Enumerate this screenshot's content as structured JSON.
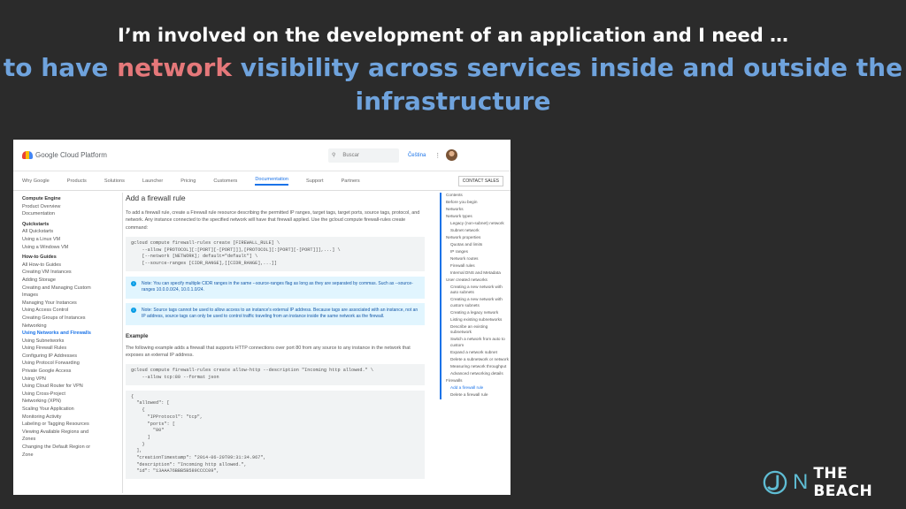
{
  "slide": {
    "title": "I’m involved on the development of an application and I need …",
    "subtitle_pre": "to have ",
    "subtitle_highlight": "network",
    "subtitle_post": " visibility across services inside and outside the infrastructure",
    "brand_n": "N",
    "brand_text": "THE BEACH"
  },
  "gcp": {
    "logo_text": "Google Cloud Platform",
    "search_placeholder": "Buscar",
    "search_icon": "magnifier-icon",
    "language": "Čeština",
    "menu_icon": "vertical-dots-icon",
    "nav": [
      "Why Google",
      "Products",
      "Solutions",
      "Launcher",
      "Pricing",
      "Customers",
      "Documentation",
      "Support",
      "Partners"
    ],
    "nav_active": "Documentation",
    "contact": "CONTACT SALES",
    "left_nav": [
      {
        "t": "Compute Engine",
        "k": "sec"
      },
      {
        "t": "Product Overview"
      },
      {
        "t": "Documentation"
      },
      {
        "t": "Quickstarts",
        "k": "sec"
      },
      {
        "t": "All Quickstarts"
      },
      {
        "t": "Using a Linux VM"
      },
      {
        "t": "Using a Windows VM"
      },
      {
        "t": "How-to Guides",
        "k": "sec"
      },
      {
        "t": "All How-to Guides"
      },
      {
        "t": "Creating VM Instances"
      },
      {
        "t": "Adding Storage"
      },
      {
        "t": "Creating and Managing Custom"
      },
      {
        "t": "Images"
      },
      {
        "t": "Managing Your Instances"
      },
      {
        "t": "Using Access Control"
      },
      {
        "t": "Creating Groups of Instances"
      },
      {
        "t": "Networking"
      },
      {
        "t": "Using Networks and Firewalls",
        "k": "act"
      },
      {
        "t": "Using Subnetworks"
      },
      {
        "t": "Using Firewall Rules"
      },
      {
        "t": "Configuring IP Addresses"
      },
      {
        "t": "Using Protocol Forwarding"
      },
      {
        "t": "Private Google Access"
      },
      {
        "t": "Using VPN"
      },
      {
        "t": "Using Cloud Router for VPN"
      },
      {
        "t": "Using Cross-Project"
      },
      {
        "t": "Networking (XPN)"
      },
      {
        "t": "Scaling Your Application"
      },
      {
        "t": "Monitoring Activity"
      },
      {
        "t": "Labeling or Tagging Resources"
      },
      {
        "t": "Viewing Available Regions and"
      },
      {
        "t": "Zones"
      },
      {
        "t": "Changing the Default Region or"
      },
      {
        "t": "Zone"
      }
    ],
    "content": {
      "heading": "Add a firewall rule",
      "intro": "To add a firewall rule, create a Firewall rule resource describing the permitted IP ranges, target tags, target ports, source tags, protocol, and network. Any instance connected to the specified network will have that firewall applied. Use the gcloud compute firewall-rules create command:",
      "code1": "gcloud compute firewall-rules create [FIREWALL_RULE] \\\n    --allow [PROTOCOL][:[PORT][-[PORT]]],[PROTOCOL][:[PORT][-[PORT]]],...] \\\n    [--network [NETWORK]; default=\"default\"] \\\n    [--source-ranges [CIDR_RANGE],[[CIDR_RANGE],...]]",
      "note1": "Note: You can specify multiple CIDR ranges in the same --source-ranges flag as long as they are separated by commas. Such as --source-ranges 10.0.0.0/24, 10.0.1.0/24.",
      "note2": "Note: Source tags cannot be used to allow access to an instance's external IP address. Because tags are associated with an instance, not an IP address, source tags can only be used to control traffic traveling from an instance inside the same network as the firewall.",
      "example_heading": "Example",
      "example_text": "The following example adds a firewall that supports HTTP connections over port 80 from any source to any instance in the network that exposes an external IP address.",
      "code2": "gcloud compute firewall-rules create allow-http --description \"Incoming http allowed.\" \\\n    --allow tcp:80 --format json",
      "code3": "{\n  \"allowed\": [\n    {\n      \"IPProtocol\": \"tcp\",\n      \"ports\": [\n        \"80\"\n      ]\n    }\n  ],\n  \"creationTimestamp\": \"2014-06-20T09:31:34.967\",\n  \"description\": \"Incoming http allowed.\",\n  \"id\": \"13AAA76BBB5B589CCCC09\","
    },
    "toc": [
      {
        "t": "Contents",
        "k": "sec"
      },
      {
        "t": "Before you begin"
      },
      {
        "t": "Networks"
      },
      {
        "t": "Network types"
      },
      {
        "t": "Legacy (non-subnet) network",
        "k": "ind"
      },
      {
        "t": "Subnet network",
        "k": "ind"
      },
      {
        "t": "Network properties"
      },
      {
        "t": "Quotas and limits",
        "k": "ind"
      },
      {
        "t": "IP ranges",
        "k": "ind"
      },
      {
        "t": "Network routes",
        "k": "ind"
      },
      {
        "t": "Firewall rules",
        "k": "ind"
      },
      {
        "t": "Internal DNS and Metadata",
        "k": "ind"
      },
      {
        "t": "User created networks"
      },
      {
        "t": "Creating a new network with auto subnets",
        "k": "ind"
      },
      {
        "t": "Creating a new network with custom subnets",
        "k": "ind"
      },
      {
        "t": "Creating a legacy network",
        "k": "ind"
      },
      {
        "t": "Listing existing subnetworks",
        "k": "ind"
      },
      {
        "t": "Describe an existing subnetwork",
        "k": "ind"
      },
      {
        "t": "Switch a network from auto to custom",
        "k": "ind"
      },
      {
        "t": "Expand a network subnet",
        "k": "ind"
      },
      {
        "t": "Delete a subnetwork or network",
        "k": "ind"
      },
      {
        "t": "Measuring network throughput",
        "k": "ind"
      },
      {
        "t": "Advanced networking details",
        "k": "ind"
      },
      {
        "t": "Firewalls"
      },
      {
        "t": "Add a firewall rule",
        "k": "ind act"
      },
      {
        "t": "Delete a firewall rule",
        "k": "ind"
      }
    ]
  }
}
